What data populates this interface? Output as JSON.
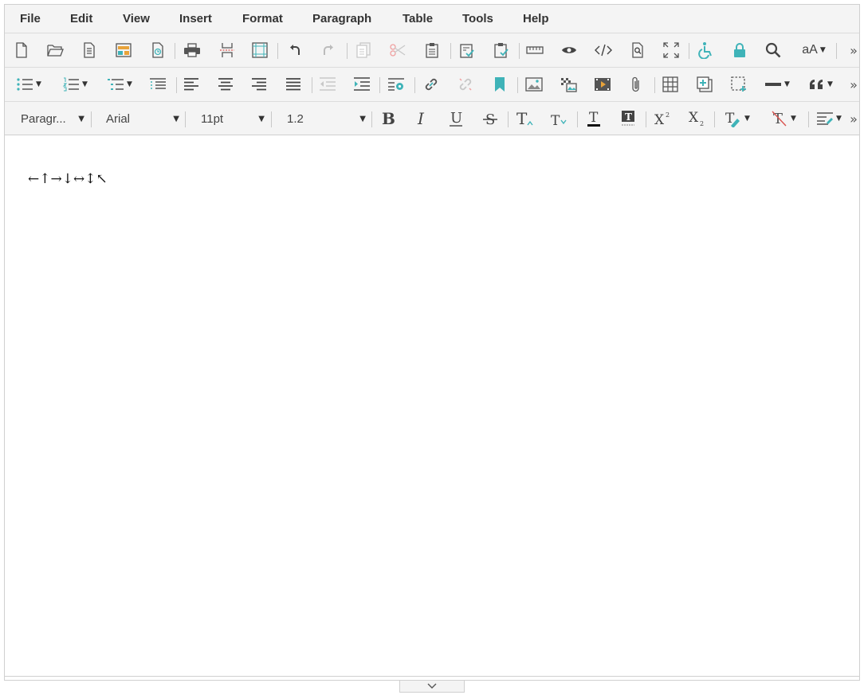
{
  "menubar": {
    "items": [
      {
        "label": "File"
      },
      {
        "label": "Edit"
      },
      {
        "label": "View"
      },
      {
        "label": "Insert"
      },
      {
        "label": "Format"
      },
      {
        "label": "Paragraph"
      },
      {
        "label": "Table"
      },
      {
        "label": "Tools"
      },
      {
        "label": "Help"
      }
    ]
  },
  "toolbar1": {
    "font_size_button_label": "aA"
  },
  "toolbar3": {
    "block_format": "Paragr...",
    "font_family": "Arial",
    "font_size": "11pt",
    "line_height": "1.2"
  },
  "document": {
    "content": "←↑→↓↔↕↖"
  },
  "colors": {
    "accent": "#3fb3b8",
    "toolbar_bg": "#f4f4f4",
    "icon": "#555555"
  }
}
